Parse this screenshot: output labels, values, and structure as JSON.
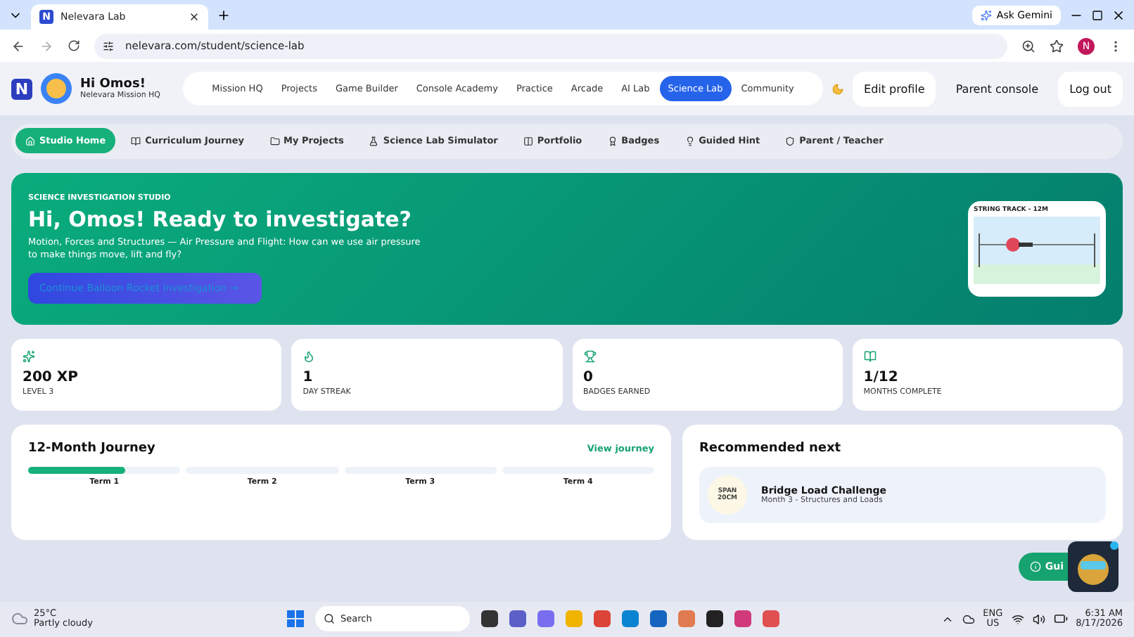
{
  "browser": {
    "tab_title": "Nelevara Lab",
    "ask_button": "Ask Gemini",
    "url": "nelevara.com/student/science-lab",
    "profile_initial": "N",
    "favicon": "N"
  },
  "header": {
    "logo": "N",
    "greeting": "Hi Omos!",
    "subtitle": "Nelevara Mission HQ",
    "nav": [
      {
        "label": "Mission HQ",
        "selected": false
      },
      {
        "label": "Projects",
        "selected": false
      },
      {
        "label": "Game Builder",
        "selected": false
      },
      {
        "label": "Console Academy",
        "selected": false
      },
      {
        "label": "Practice",
        "selected": false
      },
      {
        "label": "Arcade",
        "selected": false
      },
      {
        "label": "AI Lab",
        "selected": false
      },
      {
        "label": "Science Lab",
        "selected": true
      },
      {
        "label": "Community",
        "selected": false
      }
    ],
    "actions": [
      "Edit profile",
      "Parent console",
      "Log out"
    ]
  },
  "subnav": [
    {
      "label": "Studio Home",
      "selected": true
    },
    {
      "label": "Curriculum Journey",
      "selected": false
    },
    {
      "label": "My Projects",
      "selected": false
    },
    {
      "label": "Science Lab Simulator",
      "selected": false
    },
    {
      "label": "Portfolio",
      "selected": false
    },
    {
      "label": "Badges",
      "selected": false
    },
    {
      "label": "Guided Hint",
      "selected": false
    },
    {
      "label": "Parent / Teacher",
      "selected": false
    }
  ],
  "hero": {
    "eyebrow": "SCIENCE INVESTIGATION STUDIO",
    "title": "Hi, Omos! Ready to investigate?",
    "description": "Motion, Forces and Structures — Air Pressure and Flight: How can we use air pressure to make things move, lift and fly?",
    "button": "Continue Balloon Rocket Investigation →",
    "track_label": "STRING TRACK - 12M"
  },
  "stats": [
    {
      "value": "200 XP",
      "label": "LEVEL 3"
    },
    {
      "value": "1",
      "label": "DAY STREAK"
    },
    {
      "value": "0",
      "label": "BADGES EARNED"
    },
    {
      "value": "1/12",
      "label": "MONTHS COMPLETE"
    }
  ],
  "journey": {
    "title": "12-Month Journey",
    "link": "View journey",
    "terms": [
      {
        "label": "Term 1",
        "level": 0.64
      },
      {
        "label": "Term 2",
        "level": 0
      },
      {
        "label": "Term 3",
        "level": 0
      },
      {
        "label": "Term 4",
        "level": 0
      }
    ]
  },
  "recommended": {
    "title": "Recommended next",
    "badge_top": "SPAN",
    "badge_bottom": "20CM",
    "item_title": "Bridge Load Challenge",
    "item_subtitle": "Month 3 - Structures and Loads"
  },
  "floating": {
    "button": "Gui"
  },
  "taskbar": {
    "temperature": "25°C",
    "weather": "Partly cloudy",
    "search": "Search",
    "language": "ENG",
    "region": "US",
    "time": "6:31 AM",
    "date": "8/17/2026"
  }
}
